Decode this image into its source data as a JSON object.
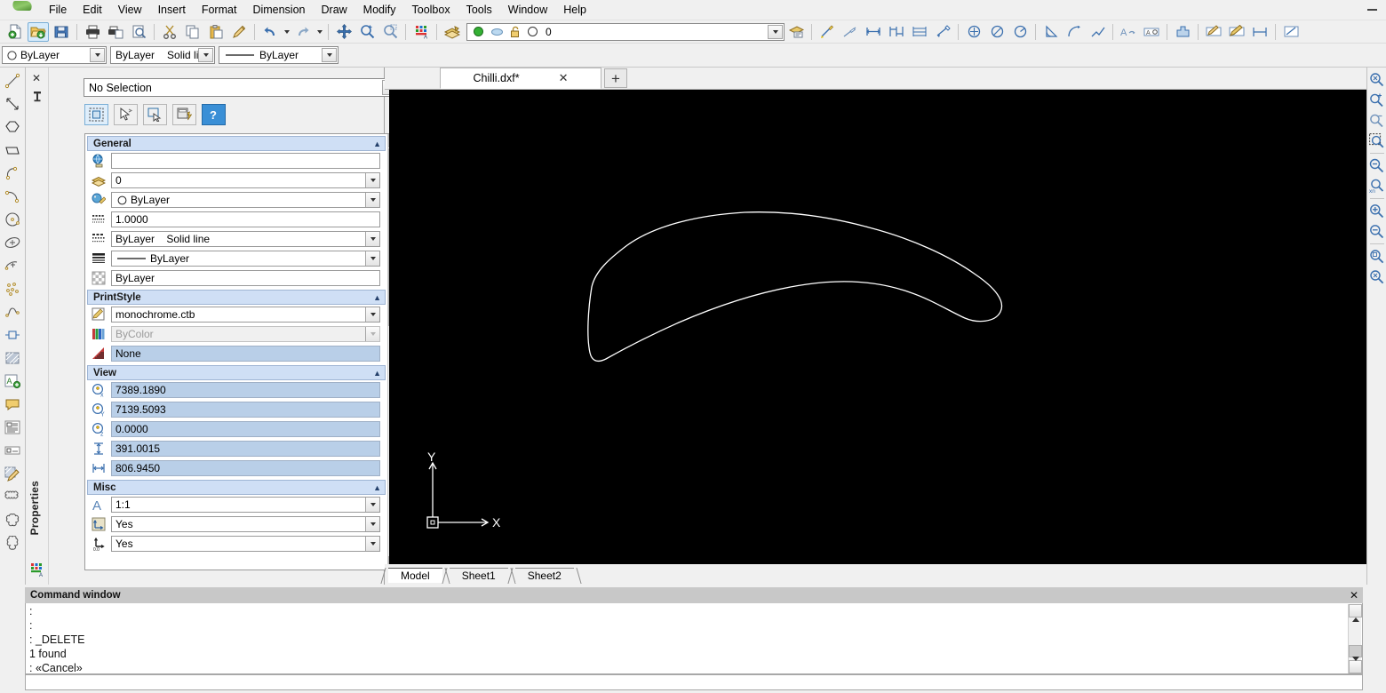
{
  "menu": {
    "items": [
      "File",
      "Edit",
      "View",
      "Insert",
      "Format",
      "Dimension",
      "Draw",
      "Modify",
      "Toolbox",
      "Tools",
      "Window",
      "Help"
    ]
  },
  "toolbar": {
    "buttons": [
      {
        "name": "new-file-icon",
        "title": "New"
      },
      {
        "name": "open-file-icon",
        "title": "Open"
      },
      {
        "name": "save-file-icon",
        "title": "Save"
      },
      {
        "name": "print-icon",
        "title": "Print"
      },
      {
        "name": "print-multiple-icon",
        "title": "Batch Print"
      },
      {
        "name": "print-preview-icon",
        "title": "Print Preview"
      },
      {
        "name": "cut-icon",
        "title": "Cut"
      },
      {
        "name": "copy-icon",
        "title": "Copy"
      },
      {
        "name": "paste-icon",
        "title": "Paste"
      },
      {
        "name": "match-properties-icon",
        "title": "Match Properties"
      },
      {
        "name": "undo-icon",
        "title": "Undo"
      },
      {
        "name": "redo-icon",
        "title": "Redo"
      },
      {
        "name": "pan-icon",
        "title": "Pan"
      },
      {
        "name": "zoom-in-icon",
        "title": "Zoom In"
      },
      {
        "name": "zoom-window-icon",
        "title": "Zoom Window"
      },
      {
        "name": "layer-states-icon",
        "title": "Layer States"
      },
      {
        "name": "layer-manager-icon",
        "title": "Layer Manager"
      },
      {
        "name": "layer-previous-icon",
        "title": "Layer Previous"
      },
      {
        "name": "linear-dimension-icon",
        "title": "Linear Dimension"
      },
      {
        "name": "aligned-dimension-icon",
        "title": "Aligned Dimension"
      },
      {
        "name": "baseline-dimension-icon",
        "title": "Baseline Dimension"
      },
      {
        "name": "continue-dimension-icon",
        "title": "Continue Dimension"
      },
      {
        "name": "ordinate-dimension-icon",
        "title": "Ordinate Dimension"
      },
      {
        "name": "leader-icon",
        "title": "Leader"
      },
      {
        "name": "center-mark-icon",
        "title": "Center Mark"
      },
      {
        "name": "diameter-dimension-icon",
        "title": "Diameter Dimension"
      },
      {
        "name": "radius-dimension-icon",
        "title": "Radius Dimension"
      },
      {
        "name": "angular-dimension-icon",
        "title": "Angular Dimension"
      },
      {
        "name": "arc-length-dimension-icon",
        "title": "Arc Length"
      },
      {
        "name": "jogged-dimension-icon",
        "title": "Jogged Dimension"
      },
      {
        "name": "text-style-icon",
        "title": "Text Style"
      },
      {
        "name": "dimension-style-icon",
        "title": "Dimension Style"
      },
      {
        "name": "tolerance-icon",
        "title": "Tolerance"
      },
      {
        "name": "edit-dimension-icon",
        "title": "Edit Dimension"
      },
      {
        "name": "edit-dimension-text-icon",
        "title": "Edit Dimension Text"
      },
      {
        "name": "dimension-update-icon",
        "title": "Dimension Update"
      },
      {
        "name": "dimension-edit-style-icon",
        "title": "Dimension Style Edit"
      }
    ],
    "layer_value": "0"
  },
  "property_toolbar": {
    "color": "ByLayer",
    "linetype_layer": "ByLayer",
    "linetype_style": "Solid line",
    "lineweight": "ByLayer"
  },
  "dock": {
    "title": "Properties",
    "close_label": "✕",
    "selection": "No Selection",
    "buttons": [
      {
        "name": "quick-select-button",
        "title": "Quick Select"
      },
      {
        "name": "select-objects-button",
        "title": "Select Objects"
      },
      {
        "name": "pick-point-button",
        "title": "Pick Point"
      },
      {
        "name": "quick-calc-button",
        "title": "Quick Calculator"
      },
      {
        "name": "help-button",
        "title": "Help"
      }
    ],
    "sections": [
      {
        "name": "General",
        "collapsed": false,
        "rows": [
          {
            "icon": "globe-hyperlink-icon",
            "value": "",
            "type": "text",
            "highlight": false
          },
          {
            "icon": "layer-stack-icon",
            "value": "0",
            "type": "combo",
            "highlight": false
          },
          {
            "icon": "color-palette-icon",
            "value": "ByLayer",
            "type": "combo",
            "highlight": false,
            "swatch": "circle"
          },
          {
            "icon": "linetype-scale-icon",
            "value": "1.0000",
            "type": "text",
            "highlight": false
          },
          {
            "icon": "linetype-icon",
            "value": "ByLayer    Solid line",
            "type": "combo",
            "highlight": false
          },
          {
            "icon": "lineweight-icon",
            "value": "ByLayer",
            "type": "combo",
            "highlight": false,
            "swatch": "line"
          },
          {
            "icon": "transparency-icon",
            "value": "ByLayer",
            "type": "text",
            "highlight": false
          }
        ]
      },
      {
        "name": "PrintStyle",
        "collapsed": false,
        "rows": [
          {
            "icon": "print-style-table-icon",
            "value": "monochrome.ctb",
            "type": "combo",
            "highlight": false
          },
          {
            "icon": "print-style-color-icon",
            "value": "ByColor",
            "type": "combo",
            "highlight": false,
            "disabled": true
          },
          {
            "icon": "print-style-name-icon",
            "value": "None",
            "type": "text",
            "highlight": true
          }
        ]
      },
      {
        "name": "View",
        "collapsed": false,
        "rows": [
          {
            "icon": "center-x-icon",
            "value": "7389.1890",
            "type": "text",
            "highlight": true
          },
          {
            "icon": "center-y-icon",
            "value": "7139.5093",
            "type": "text",
            "highlight": true
          },
          {
            "icon": "center-z-icon",
            "value": "0.0000",
            "type": "text",
            "highlight": true
          },
          {
            "icon": "view-height-icon",
            "value": "391.0015",
            "type": "text",
            "highlight": true
          },
          {
            "icon": "view-width-icon",
            "value": "806.9450",
            "type": "text",
            "highlight": true
          }
        ]
      },
      {
        "name": "Misc",
        "collapsed": false,
        "rows": [
          {
            "icon": "annotation-scale-icon",
            "value": "1:1",
            "type": "combo",
            "highlight": false
          },
          {
            "icon": "ucs-icon-on-icon",
            "value": "Yes",
            "type": "combo",
            "highlight": false
          },
          {
            "icon": "ucs-icon-at-origin-icon",
            "value": "Yes",
            "type": "combo",
            "highlight": false
          }
        ]
      }
    ]
  },
  "document": {
    "tab_label": "Chilli.dxf*",
    "close_label": "✕",
    "new_tab_label": "+"
  },
  "sheets": {
    "tabs": [
      {
        "label": "Model",
        "active": true
      },
      {
        "label": "Sheet1",
        "active": false
      },
      {
        "label": "Sheet2",
        "active": false
      }
    ]
  },
  "canvas": {
    "background": "#000000",
    "stroke": "#ffffff",
    "ucs": {
      "x_label": "X",
      "y_label": "Y"
    }
  },
  "left_tools": [
    {
      "name": "line-tool-icon"
    },
    {
      "name": "infinite-line-tool-icon"
    },
    {
      "name": "polygon-tool-icon"
    },
    {
      "name": "rectangle-tool-icon"
    },
    {
      "name": "arc-tool-icon"
    },
    {
      "name": "arc-start-end-tool-icon"
    },
    {
      "name": "circle-tool-icon"
    },
    {
      "name": "ellipse-tool-icon"
    },
    {
      "name": "ellipse-arc-tool-icon"
    },
    {
      "name": "point-tool-icon"
    },
    {
      "name": "spline-tool-icon"
    },
    {
      "name": "block-insert-tool-icon"
    },
    {
      "name": "hatch-tool-icon"
    },
    {
      "name": "text-tool-icon"
    },
    {
      "name": "multileader-tool-icon"
    },
    {
      "name": "mtext-tool-icon"
    },
    {
      "name": "single-text-tool-icon"
    },
    {
      "name": "edit-hatch-tool-icon"
    },
    {
      "name": "revision-cloud-tool-icon"
    },
    {
      "name": "cloud-polygon-tool-icon"
    },
    {
      "name": "cloud-free-tool-icon"
    }
  ],
  "right_tools": [
    {
      "name": "zoom-all-icon"
    },
    {
      "name": "zoom-in-plus-icon"
    },
    {
      "name": "zoom-out-minus-icon"
    },
    {
      "name": "zoom-window-icon"
    },
    {
      "name": "zoom-previous-icon"
    },
    {
      "name": "zoom-scale-icon"
    },
    {
      "name": "zoom-in-icon"
    },
    {
      "name": "zoom-out-icon"
    },
    {
      "name": "zoom-realtime-icon"
    },
    {
      "name": "zoom-extents-icon"
    }
  ],
  "command_window": {
    "title": "Command window",
    "close_label": "✕",
    "lines": [
      ": ",
      ": ",
      ": _DELETE",
      "1 found",
      ": «Cancel»",
      ": «Cancel»"
    ],
    "input_value": ""
  },
  "colors": {
    "accent": "#cfdff5",
    "highlight_row": "#b9cfe8",
    "canvas_bg": "#000000",
    "chrome": "#f0f0f0"
  }
}
